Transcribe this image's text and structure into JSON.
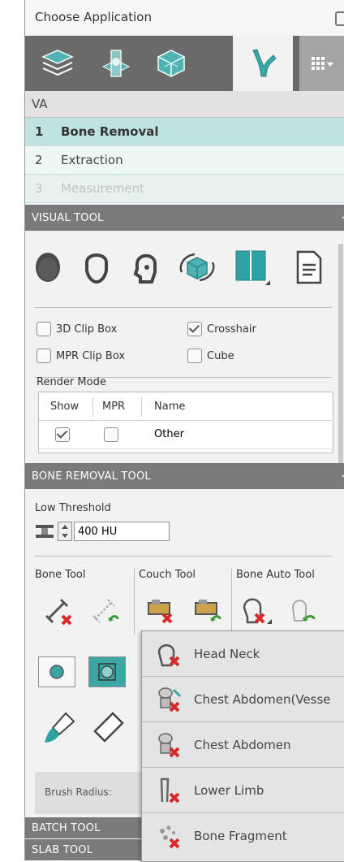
{
  "header": {
    "title": "Choose Application"
  },
  "app_bar": {
    "icons": [
      "layers-icon",
      "slice-plane-icon",
      "volume-cube-icon",
      "vessel-icon",
      "grid-menu-icon"
    ],
    "active_index": 3
  },
  "workflow": {
    "title": "VA",
    "steps": [
      {
        "num": "1",
        "label": "Bone Removal",
        "state": "active"
      },
      {
        "num": "2",
        "label": "Extraction",
        "state": "normal"
      },
      {
        "num": "3",
        "label": "Measurement",
        "state": "disabled"
      }
    ]
  },
  "visual_tool": {
    "title": "VISUAL TOOL",
    "icons": [
      "head-top-icon",
      "head-front-icon",
      "head-side-icon",
      "rotate-cube-icon",
      "layout-icon",
      "report-icon"
    ],
    "checkboxes": [
      {
        "label": "3D Clip Box",
        "checked": false
      },
      {
        "label": "Crosshair",
        "checked": true
      },
      {
        "label": "MPR Clip Box",
        "checked": false
      },
      {
        "label": "Cube",
        "checked": false
      }
    ],
    "render_mode_label": "Render Mode",
    "table": {
      "headers": [
        "Show",
        "MPR",
        "Name"
      ],
      "rows": [
        {
          "show": true,
          "mpr": false,
          "name": "Other"
        }
      ]
    }
  },
  "bone_removal_tool": {
    "title": "BONE REMOVAL TOOL",
    "low_threshold_label": "Low Threshold",
    "threshold_value": "400 HU",
    "groups": [
      "Bone Tool",
      "Couch Tool",
      "Bone Auto Tool"
    ],
    "brush_radius_label": "Brush Radius:"
  },
  "batch_tool": {
    "title": "BATCH TOOL"
  },
  "slab_tool": {
    "title": "SLAB TOOL"
  },
  "auto_menu": {
    "items": [
      {
        "label": "Head Neck",
        "icon": "head-neck-remove-icon"
      },
      {
        "label": "Chest Abdomen(Vesse",
        "icon": "chest-abdomen-vessel-icon"
      },
      {
        "label": "Chest Abdomen",
        "icon": "chest-abdomen-remove-icon"
      },
      {
        "label": "Lower Limb",
        "icon": "lower-limb-remove-icon"
      },
      {
        "label": "Bone Fragment",
        "icon": "bone-fragment-remove-icon"
      }
    ]
  },
  "colors": {
    "active_step": "#bfe3e3",
    "header_bar": "#7a7a7a",
    "app_bar": "#6a6a6a",
    "accent_teal": "#3aa6a6",
    "remove_red": "#d92a2a"
  }
}
